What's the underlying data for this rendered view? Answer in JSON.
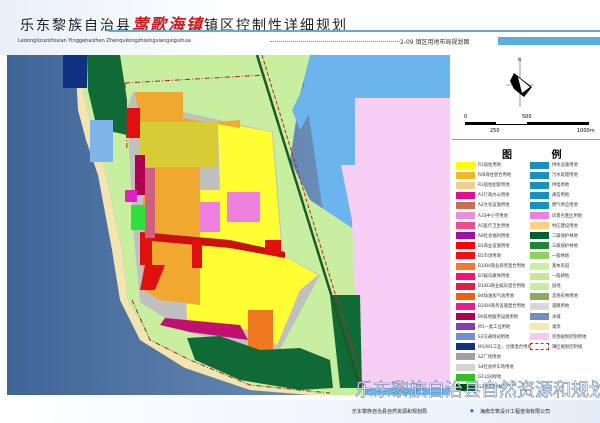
{
  "header": {
    "title_prefix": "乐东黎族自治县",
    "title_town": "莺歌海镇",
    "title_suffix": "镇区控制性详细规划",
    "pinyin": "Ledonglizuzizhixian  Yinggehaizhen  Zhenqukongzhixingxiangxiguihua",
    "drawing_title": "2-09  镇区用地布局规划图"
  },
  "scale": {
    "labels": [
      "0",
      "250",
      "500",
      "1000m"
    ]
  },
  "compass": {
    "north": "N"
  },
  "legend": {
    "title": "图  例",
    "left": [
      {
        "label": "R1居住用地",
        "color": "#ffff00"
      },
      {
        "label": "R/B商住混合用地",
        "color": "#f5b820"
      },
      {
        "label": "R3居住配套用地",
        "color": "#efd08a"
      },
      {
        "label": "A1行政办公用地",
        "color": "#e0108a"
      },
      {
        "label": "A2文化设施用地",
        "color": "#c87050"
      },
      {
        "label": "A33中小学用地",
        "color": "#e890e0"
      },
      {
        "label": "A5医疗卫生用地",
        "color": "#e85090"
      },
      {
        "label": "A6社会福利用地",
        "color": "#a010a0"
      },
      {
        "label": "B1商业设施用地",
        "color": "#ff0000"
      },
      {
        "label": "B1市场用地",
        "color": "#ee1111"
      },
      {
        "label": "B1/B4商业商务混合用地",
        "color": "#f07830"
      },
      {
        "label": "B3娱乐康体用地",
        "color": "#ff1070"
      },
      {
        "label": "B1/B3商业娱乐混合用地",
        "color": "#dd2244"
      },
      {
        "label": "B4加油加气站用地",
        "color": "#f06010"
      },
      {
        "label": "B2/B4商务设施混合用地",
        "color": "#e02090"
      },
      {
        "label": "B9其他服务设施用地",
        "color": "#b00050"
      },
      {
        "label": "M1一类工业用地",
        "color": "#8040b0"
      },
      {
        "label": "S3交通场站用地",
        "color": "#7090d0"
      },
      {
        "label": "M1/W1工业、仓储混合用地",
        "color": "#103080"
      },
      {
        "label": "S2广场用地",
        "color": "#a0a0a0"
      },
      {
        "label": "S4社会停车场用地",
        "color": "#d4d4d4"
      },
      {
        "label": "G1公园绿地",
        "color": "#30c020"
      },
      {
        "label": "G2防护绿地",
        "color": "#005000"
      }
    ],
    "right": [
      {
        "label": "供水设施用地",
        "color": "#1890c0"
      },
      {
        "label": "污水处理用地",
        "color": "#1890c0"
      },
      {
        "label": "供电用地",
        "color": "#1890c0"
      },
      {
        "label": "通信用地",
        "color": "#1890c0"
      },
      {
        "label": "燃气供应用地",
        "color": "#1890c0"
      },
      {
        "label": "风景名胜区用地",
        "color": "#f080e0"
      },
      {
        "label": "村庄建设用地",
        "color": "#ffd080"
      },
      {
        "label": "二级保护林地",
        "color": "#006030"
      },
      {
        "label": "三级保护林地",
        "color": "#208830"
      },
      {
        "label": "一般林地",
        "color": "#90d060"
      },
      {
        "label": "基本农田",
        "color": "#c8f0a0"
      },
      {
        "label": "一般耕地",
        "color": "#c8e890"
      },
      {
        "label": "园地",
        "color": "#c0f0a0"
      },
      {
        "label": "其他农林用地",
        "color": "#90a860"
      },
      {
        "label": "道路用地",
        "color": "#d8d8d8"
      },
      {
        "label": "水域",
        "color": "#7090c0"
      },
      {
        "label": "滩涂",
        "color": "#f8e8b0"
      },
      {
        "label": "外围规划控制用地",
        "color": "#f8c8f0"
      },
      {
        "label": "镇区规划控制线",
        "color": "#cc2222"
      }
    ]
  },
  "watermark": "乐东黎族自治县自然资源和规划局",
  "footer": {
    "left": "乐东黎族自治县自然资源和规划局",
    "right": "海南华筑设计工程咨询有限公司"
  }
}
